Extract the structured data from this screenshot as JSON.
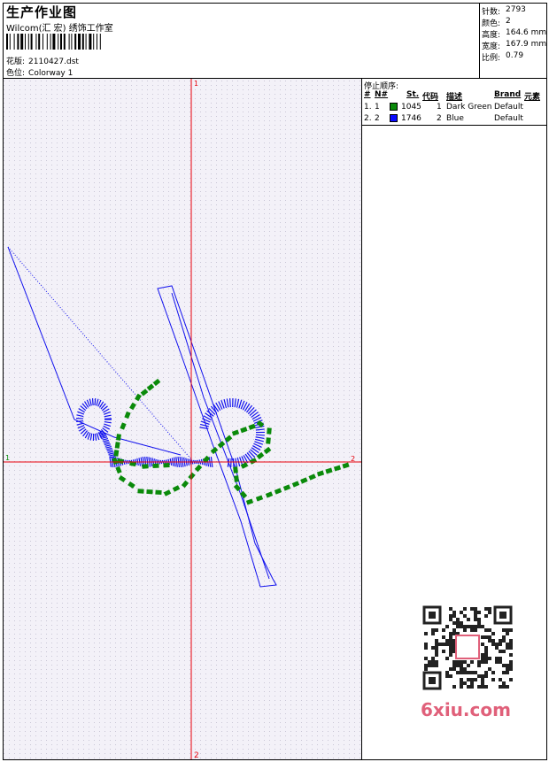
{
  "header": {
    "title": "生产作业图",
    "studio": "Wilcom(汇 宏) 绣饰工作室",
    "design_label": "花版:",
    "design_value": "2110427.dst",
    "colorway_label": "色位:",
    "colorway_value": "Colorway 1"
  },
  "stats": [
    {
      "label": "针数:",
      "value": "2793"
    },
    {
      "label": "颜色:",
      "value": "2"
    },
    {
      "label": "高度:",
      "value": "164.6 mm"
    },
    {
      "label": "宽度:",
      "value": "167.9 mm"
    },
    {
      "label": "比例:",
      "value": "0.79"
    }
  ],
  "axes": {
    "top": "1",
    "left": "1",
    "right": "2",
    "bottom": "2",
    "color": "#e8000a"
  },
  "stop_sequence": {
    "title": "停止顺序:",
    "columns": [
      "#",
      "N#",
      "St.",
      "代码",
      "描述",
      "Brand",
      "元素"
    ],
    "rows": [
      {
        "index": "1.",
        "n": "1",
        "color": "#0a8a0a",
        "stitches": "1045",
        "code": "1",
        "desc": "Dark Green",
        "brand": "Default"
      },
      {
        "index": "2.",
        "n": "2",
        "color": "#0a0aff",
        "stitches": "1746",
        "code": "2",
        "desc": "Blue",
        "brand": "Default"
      }
    ]
  },
  "watermark": {
    "text": "6xiu.com"
  },
  "colors": {
    "green": "#0a8a0a",
    "blue": "#0a0aff",
    "canvas": "#f3f1f8"
  }
}
